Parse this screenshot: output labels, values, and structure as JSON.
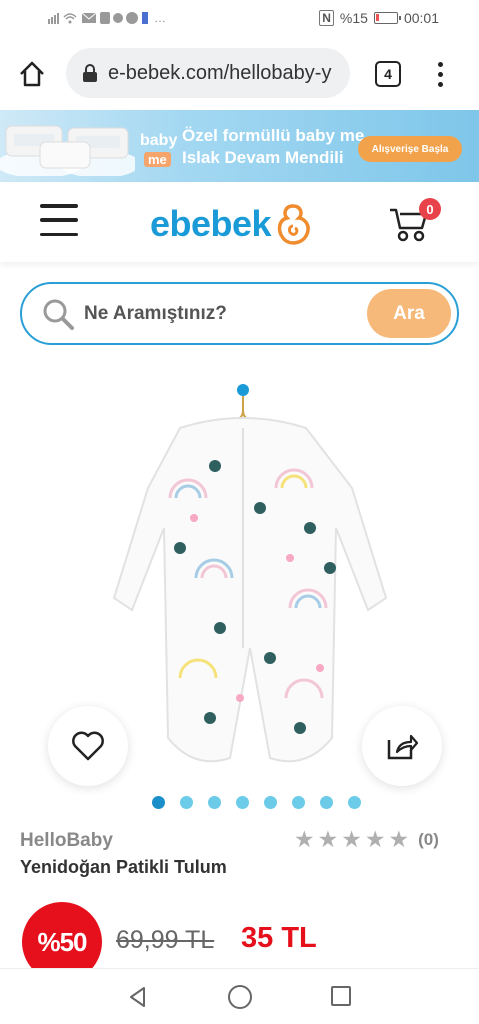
{
  "status_bar": {
    "left_icons": "…",
    "battery_percent": "%15",
    "time": "00:01"
  },
  "browser": {
    "url": "e-bebek.com/hellobaby-y",
    "tab_count": "4"
  },
  "banner": {
    "brand_line1": "baby",
    "brand_line2": "me",
    "title_line1": "Özel formüllü baby me",
    "title_line2": "Islak Devam Mendili",
    "cta": "Alışverişe Başla"
  },
  "header": {
    "logo": "ebebek",
    "cart_count": "0"
  },
  "search": {
    "placeholder": "Ne Aramıştınız?",
    "button": "Ara"
  },
  "gallery": {
    "dots": 8,
    "active_index": 0
  },
  "product": {
    "brand": "HelloBaby",
    "name": "Yenidoğan Patikli Tulum",
    "rating_count": "(0)",
    "discount": "%50",
    "old_price": "69,99 TL",
    "new_price": "35 TL"
  },
  "colors": {
    "brand_blue": "#1a9bd7",
    "search_orange": "#f6b97a",
    "price_red": "#e6101c"
  }
}
